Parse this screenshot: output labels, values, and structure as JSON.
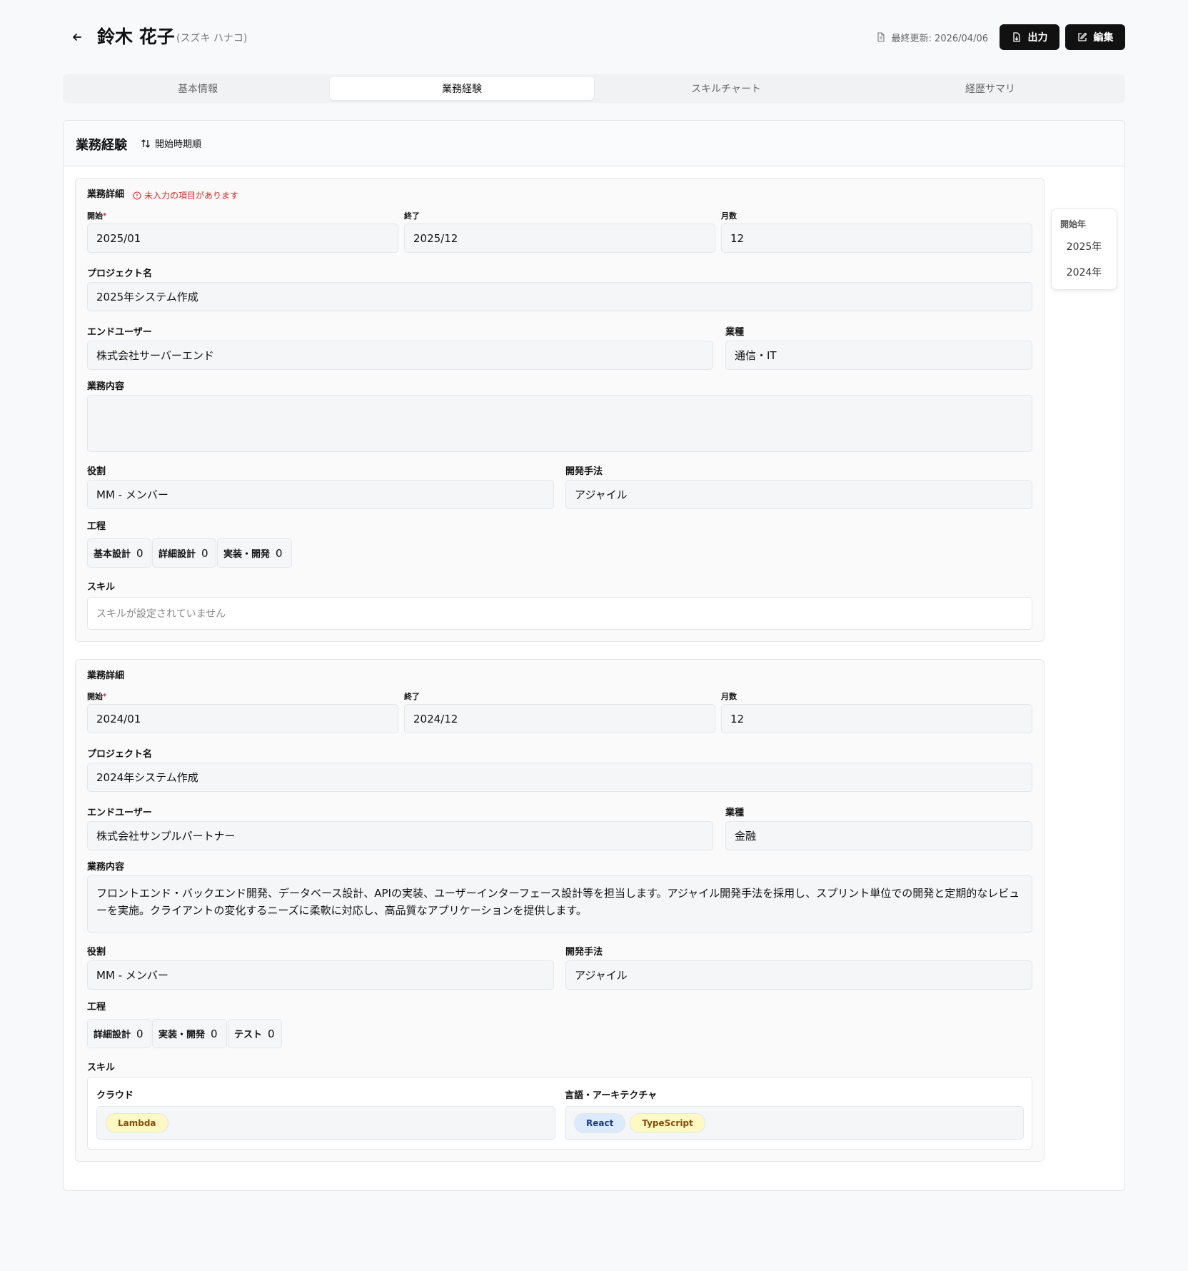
{
  "header": {
    "name": "鈴木 花子",
    "kana": "(スズキ ハナコ)",
    "updated": "最終更新: 2026/04/06",
    "export_label": "出力",
    "edit_label": "編集"
  },
  "tabs": [
    "基本情報",
    "業務経験",
    "スキルチャート",
    "経歴サマリ"
  ],
  "active_tab": "業務経験",
  "section": {
    "title": "業務経験",
    "sort_label": "開始時期順"
  },
  "labels": {
    "detail": "業務詳細",
    "start": "開始",
    "required": "*",
    "end": "終了",
    "months": "月数",
    "project": "プロジェクト名",
    "end_user": "エンドユーザー",
    "industry": "業種",
    "content": "業務内容",
    "role": "役割",
    "method": "開発手法",
    "process": "工程",
    "skills": "スキル"
  },
  "entries": [
    {
      "warning": "未入力の項目があります",
      "start": "2025/01",
      "end": "2025/12",
      "months": "12",
      "project": "2025年システム作成",
      "end_user": "株式会社サーバーエンド",
      "industry": "通信・IT",
      "content": "",
      "role": "MM - メンバー",
      "method": "アジャイル",
      "processes": [
        {
          "name": "基本設計",
          "value": "0"
        },
        {
          "name": "詳細設計",
          "value": "0"
        },
        {
          "name": "実装・開発",
          "value": "0"
        }
      ],
      "skills_empty": "スキルが設定されていません"
    },
    {
      "start": "2024/01",
      "end": "2024/12",
      "months": "12",
      "project": "2024年システム作成",
      "end_user": "株式会社サンプルパートナー",
      "industry": "金融",
      "content": "フロントエンド・バックエンド開発、データベース設計、APIの実装、ユーザーインターフェース設計等を担当します。アジャイル開発手法を採用し、スプリント単位での開発と定期的なレビューを実施。クライアントの変化するニーズに柔軟に対応し、高品質なアプリケーションを提供します。",
      "role": "MM - メンバー",
      "method": "アジャイル",
      "processes": [
        {
          "name": "詳細設計",
          "value": "0"
        },
        {
          "name": "実装・開発",
          "value": "0"
        },
        {
          "name": "テスト",
          "value": "0"
        }
      ],
      "skill_categories": [
        {
          "title": "クラウド",
          "tags": [
            {
              "name": "Lambda",
              "color": "yellow"
            }
          ]
        },
        {
          "title": "言語・アーキテクチャ",
          "tags": [
            {
              "name": "React",
              "color": "blue"
            },
            {
              "name": "TypeScript",
              "color": "yellow"
            }
          ]
        }
      ]
    }
  ],
  "year_nav": {
    "title": "開始年",
    "years": [
      "2025年",
      "2024年"
    ]
  },
  "colors": {
    "primary_button": "#111111",
    "warning": "#dc2626",
    "tag_yellow": "#fef9c3",
    "tag_blue": "#dbeafe"
  }
}
